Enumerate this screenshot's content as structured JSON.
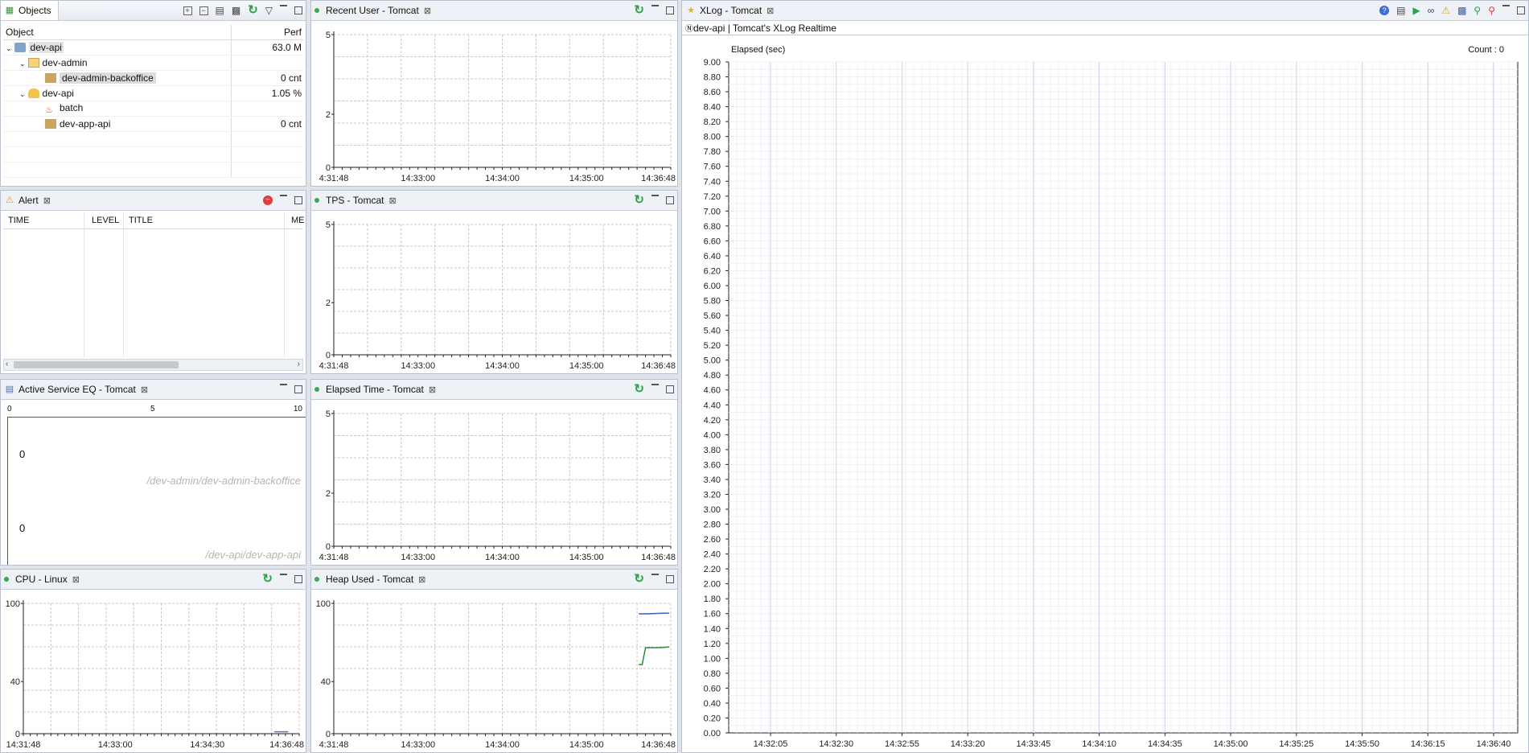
{
  "objects_panel": {
    "tab_title": "Objects",
    "columns": {
      "object": "Object",
      "perf": "Perf"
    },
    "rows": [
      {
        "name": "dev-api",
        "perf": "63.0 M"
      },
      {
        "name": "dev-admin",
        "perf": ""
      },
      {
        "name": "dev-admin-backoffice",
        "perf": "0 cnt"
      },
      {
        "name": "dev-api",
        "perf": "1.05 %"
      },
      {
        "name": "batch",
        "perf": ""
      },
      {
        "name": "dev-app-api",
        "perf": "0 cnt"
      }
    ]
  },
  "alert_panel": {
    "tab_title": "Alert",
    "columns": {
      "time": "TIME",
      "level": "LEVEL",
      "title": "TITLE",
      "message": "ME"
    }
  },
  "aseq_panel": {
    "tab_title": "Active Service EQ - Tomcat",
    "scale": [
      "0",
      "5",
      "10"
    ],
    "entries": [
      {
        "value": "0",
        "path": "/dev-admin/dev-admin-backoffice"
      },
      {
        "value": "0",
        "path": "/dev-api/dev-app-api"
      }
    ]
  },
  "xlog_panel": {
    "tab_title": "XLog - Tomcat",
    "subtitle": "dev-api | Tomcat's XLog Realtime",
    "ylabel": "Elapsed (sec)",
    "count_label": "Count : 0"
  },
  "chart_data": [
    {
      "id": "recent_user",
      "tab_title": "Recent User - Tomcat",
      "type": "line",
      "y_ticks": [
        "0",
        "2",
        "5"
      ],
      "ylim": [
        0,
        5
      ],
      "x_ticks": [
        "4:31:48",
        "14:33:00",
        "14:34:00",
        "14:35:00",
        "14:36:48"
      ],
      "series": []
    },
    {
      "id": "tps",
      "tab_title": "TPS - Tomcat",
      "type": "line",
      "y_ticks": [
        "0",
        "2",
        "5"
      ],
      "ylim": [
        0,
        5
      ],
      "x_ticks": [
        "4:31:48",
        "14:33:00",
        "14:34:00",
        "14:35:00",
        "14:36:48"
      ],
      "series": []
    },
    {
      "id": "elapsed",
      "tab_title": "Elapsed Time - Tomcat",
      "type": "line",
      "y_ticks": [
        "0",
        "2",
        "5"
      ],
      "ylim": [
        0,
        5
      ],
      "x_ticks": [
        "4:31:48",
        "14:33:00",
        "14:34:00",
        "14:35:00",
        "14:36:48"
      ],
      "series": []
    },
    {
      "id": "cpu",
      "tab_title": "CPU - Linux",
      "type": "line",
      "y_ticks": [
        "0",
        "40",
        "100"
      ],
      "ylim": [
        0,
        100
      ],
      "x_ticks": [
        "14:31:48",
        "14:33:00",
        "14:34:30",
        "14:36:48"
      ],
      "series": [
        {
          "color": "#5b6fb5",
          "points": [
            [
              0.91,
              1.5
            ],
            [
              0.96,
              1.5
            ]
          ]
        }
      ]
    },
    {
      "id": "heap",
      "tab_title": "Heap Used - Tomcat",
      "type": "line",
      "y_ticks": [
        "0",
        "40",
        "100"
      ],
      "ylim": [
        0,
        100
      ],
      "x_ticks": [
        "4:31:48",
        "14:33:00",
        "14:34:00",
        "14:35:00",
        "14:36:48"
      ],
      "series": [
        {
          "color": "#3c5fb0",
          "points": [
            [
              0.905,
              92
            ],
            [
              0.93,
              92
            ],
            [
              0.96,
              92.3
            ],
            [
              0.995,
              92.5
            ]
          ]
        },
        {
          "color": "#2f8a3c",
          "points": [
            [
              0.905,
              53
            ],
            [
              0.915,
              53
            ],
            [
              0.925,
              66
            ],
            [
              0.96,
              66
            ],
            [
              0.995,
              66.5
            ]
          ]
        }
      ]
    },
    {
      "id": "xlog",
      "type": "scatter",
      "ylim": [
        0,
        9
      ],
      "y_ticks": [
        "0.00",
        "0.20",
        "0.40",
        "0.60",
        "0.80",
        "1.00",
        "1.20",
        "1.40",
        "1.60",
        "1.80",
        "2.00",
        "2.20",
        "2.40",
        "2.60",
        "2.80",
        "3.00",
        "3.20",
        "3.40",
        "3.60",
        "3.80",
        "4.00",
        "4.20",
        "4.40",
        "4.60",
        "4.80",
        "5.00",
        "5.20",
        "5.40",
        "5.60",
        "5.80",
        "6.00",
        "6.20",
        "6.40",
        "6.60",
        "6.80",
        "7.00",
        "7.20",
        "7.40",
        "7.60",
        "7.80",
        "8.00",
        "8.20",
        "8.40",
        "8.60",
        "8.80",
        "9.00"
      ],
      "x_ticks": [
        "14:32:05",
        "14:32:30",
        "14:32:55",
        "14:33:20",
        "14:33:45",
        "14:34:10",
        "14:34:35",
        "14:35:00",
        "14:35:25",
        "14:35:50",
        "14:36:15",
        "14:36:40"
      ],
      "series": []
    }
  ]
}
